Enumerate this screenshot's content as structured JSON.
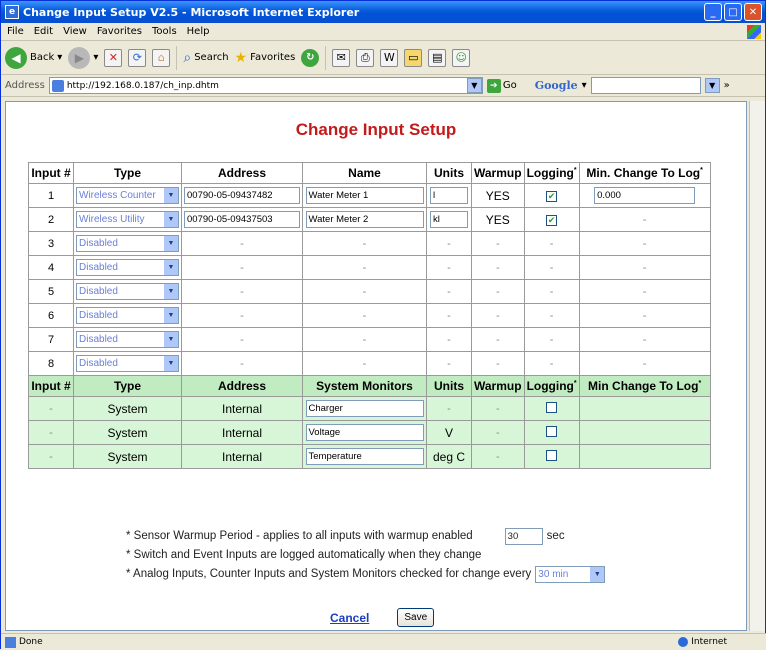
{
  "window": {
    "title": "Change Input Setup V2.5 - Microsoft Internet Explorer"
  },
  "menu": [
    "File",
    "Edit",
    "View",
    "Favorites",
    "Tools",
    "Help"
  ],
  "toolbar": {
    "back": "Back",
    "search": "Search",
    "favorites": "Favorites",
    "go": "Go"
  },
  "address": {
    "label": "Address",
    "url": "http://192.168.0.187/ch_inp.dhtm"
  },
  "google": {
    "label": "Google"
  },
  "page": {
    "title": "Change Input Setup"
  },
  "table": {
    "headers": [
      "Input #",
      "Type",
      "Address",
      "Name",
      "Units",
      "Warmup",
      "Logging",
      "Min. Change To Log"
    ],
    "rows": [
      {
        "num": "1",
        "type": "Wireless Counter",
        "address": "00790-05-09437482",
        "name": "Water Meter 1",
        "units": "l",
        "warmup": "YES",
        "logging": "☑",
        "min": "0.000"
      },
      {
        "num": "2",
        "type": "Wireless Utility",
        "address": "00790-05-09437503",
        "name": "Water Meter 2",
        "units": "kl",
        "warmup": "YES",
        "logging": "☑",
        "min": "-"
      },
      {
        "num": "3",
        "type": "Disabled",
        "address": "-",
        "name": "-",
        "units": "-",
        "warmup": "-",
        "logging": "-",
        "min": "-"
      },
      {
        "num": "4",
        "type": "Disabled",
        "address": "-",
        "name": "-",
        "units": "-",
        "warmup": "-",
        "logging": "-",
        "min": "-"
      },
      {
        "num": "5",
        "type": "Disabled",
        "address": "-",
        "name": "-",
        "units": "-",
        "warmup": "-",
        "logging": "-",
        "min": "-"
      },
      {
        "num": "6",
        "type": "Disabled",
        "address": "-",
        "name": "-",
        "units": "-",
        "warmup": "-",
        "logging": "-",
        "min": "-"
      },
      {
        "num": "7",
        "type": "Disabled",
        "address": "-",
        "name": "-",
        "units": "-",
        "warmup": "-",
        "logging": "-",
        "min": "-"
      },
      {
        "num": "8",
        "type": "Disabled",
        "address": "-",
        "name": "-",
        "units": "-",
        "warmup": "-",
        "logging": "-",
        "min": "-"
      }
    ],
    "sys_headers": [
      "Input #",
      "Type",
      "Address",
      "System Monitors",
      "Units",
      "Warmup",
      "Logging",
      "Min Change To Log"
    ],
    "sys_rows": [
      {
        "num": "-",
        "type": "System",
        "address": "Internal",
        "name": "Charger",
        "units": "-",
        "warmup": "-"
      },
      {
        "num": "-",
        "type": "System",
        "address": "Internal",
        "name": "Voltage",
        "units": "V",
        "warmup": "-"
      },
      {
        "num": "-",
        "type": "System",
        "address": "Internal",
        "name": "Temperature",
        "units": "deg C",
        "warmup": "-"
      }
    ]
  },
  "notes": {
    "warmup": "* Sensor Warmup Period - applies to all inputs with warmup enabled",
    "warmup_value": "30",
    "warmup_unit": "sec",
    "switch": "* Switch and Event Inputs are logged automatically when they change",
    "analog": "* Analog Inputs, Counter Inputs and System Monitors checked for change every",
    "interval": "30 min"
  },
  "actions": {
    "cancel": "Cancel",
    "save": "Save"
  },
  "status": {
    "left": "Done",
    "zone": "Internet"
  }
}
